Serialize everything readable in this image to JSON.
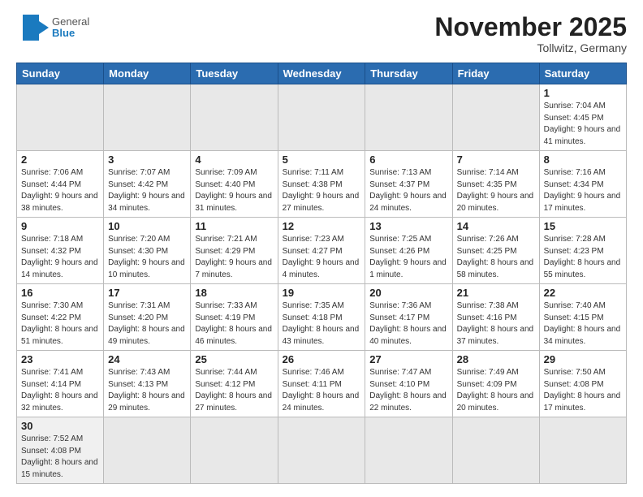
{
  "header": {
    "logo_general": "General",
    "logo_blue": "Blue",
    "month_title": "November 2025",
    "subtitle": "Tollwitz, Germany"
  },
  "weekdays": [
    "Sunday",
    "Monday",
    "Tuesday",
    "Wednesday",
    "Thursday",
    "Friday",
    "Saturday"
  ],
  "weeks": [
    [
      {
        "day": "",
        "info": "",
        "empty": true
      },
      {
        "day": "",
        "info": "",
        "empty": true
      },
      {
        "day": "",
        "info": "",
        "empty": true
      },
      {
        "day": "",
        "info": "",
        "empty": true
      },
      {
        "day": "",
        "info": "",
        "empty": true
      },
      {
        "day": "",
        "info": "",
        "empty": true
      },
      {
        "day": "1",
        "info": "Sunrise: 7:04 AM\nSunset: 4:45 PM\nDaylight: 9 hours\nand 41 minutes."
      }
    ],
    [
      {
        "day": "2",
        "info": "Sunrise: 7:06 AM\nSunset: 4:44 PM\nDaylight: 9 hours\nand 38 minutes."
      },
      {
        "day": "3",
        "info": "Sunrise: 7:07 AM\nSunset: 4:42 PM\nDaylight: 9 hours\nand 34 minutes."
      },
      {
        "day": "4",
        "info": "Sunrise: 7:09 AM\nSunset: 4:40 PM\nDaylight: 9 hours\nand 31 minutes."
      },
      {
        "day": "5",
        "info": "Sunrise: 7:11 AM\nSunset: 4:38 PM\nDaylight: 9 hours\nand 27 minutes."
      },
      {
        "day": "6",
        "info": "Sunrise: 7:13 AM\nSunset: 4:37 PM\nDaylight: 9 hours\nand 24 minutes."
      },
      {
        "day": "7",
        "info": "Sunrise: 7:14 AM\nSunset: 4:35 PM\nDaylight: 9 hours\nand 20 minutes."
      },
      {
        "day": "8",
        "info": "Sunrise: 7:16 AM\nSunset: 4:34 PM\nDaylight: 9 hours\nand 17 minutes."
      }
    ],
    [
      {
        "day": "9",
        "info": "Sunrise: 7:18 AM\nSunset: 4:32 PM\nDaylight: 9 hours\nand 14 minutes."
      },
      {
        "day": "10",
        "info": "Sunrise: 7:20 AM\nSunset: 4:30 PM\nDaylight: 9 hours\nand 10 minutes."
      },
      {
        "day": "11",
        "info": "Sunrise: 7:21 AM\nSunset: 4:29 PM\nDaylight: 9 hours\nand 7 minutes."
      },
      {
        "day": "12",
        "info": "Sunrise: 7:23 AM\nSunset: 4:27 PM\nDaylight: 9 hours\nand 4 minutes."
      },
      {
        "day": "13",
        "info": "Sunrise: 7:25 AM\nSunset: 4:26 PM\nDaylight: 9 hours\nand 1 minute."
      },
      {
        "day": "14",
        "info": "Sunrise: 7:26 AM\nSunset: 4:25 PM\nDaylight: 8 hours\nand 58 minutes."
      },
      {
        "day": "15",
        "info": "Sunrise: 7:28 AM\nSunset: 4:23 PM\nDaylight: 8 hours\nand 55 minutes."
      }
    ],
    [
      {
        "day": "16",
        "info": "Sunrise: 7:30 AM\nSunset: 4:22 PM\nDaylight: 8 hours\nand 51 minutes."
      },
      {
        "day": "17",
        "info": "Sunrise: 7:31 AM\nSunset: 4:20 PM\nDaylight: 8 hours\nand 49 minutes."
      },
      {
        "day": "18",
        "info": "Sunrise: 7:33 AM\nSunset: 4:19 PM\nDaylight: 8 hours\nand 46 minutes."
      },
      {
        "day": "19",
        "info": "Sunrise: 7:35 AM\nSunset: 4:18 PM\nDaylight: 8 hours\nand 43 minutes."
      },
      {
        "day": "20",
        "info": "Sunrise: 7:36 AM\nSunset: 4:17 PM\nDaylight: 8 hours\nand 40 minutes."
      },
      {
        "day": "21",
        "info": "Sunrise: 7:38 AM\nSunset: 4:16 PM\nDaylight: 8 hours\nand 37 minutes."
      },
      {
        "day": "22",
        "info": "Sunrise: 7:40 AM\nSunset: 4:15 PM\nDaylight: 8 hours\nand 34 minutes."
      }
    ],
    [
      {
        "day": "23",
        "info": "Sunrise: 7:41 AM\nSunset: 4:14 PM\nDaylight: 8 hours\nand 32 minutes."
      },
      {
        "day": "24",
        "info": "Sunrise: 7:43 AM\nSunset: 4:13 PM\nDaylight: 8 hours\nand 29 minutes."
      },
      {
        "day": "25",
        "info": "Sunrise: 7:44 AM\nSunset: 4:12 PM\nDaylight: 8 hours\nand 27 minutes."
      },
      {
        "day": "26",
        "info": "Sunrise: 7:46 AM\nSunset: 4:11 PM\nDaylight: 8 hours\nand 24 minutes."
      },
      {
        "day": "27",
        "info": "Sunrise: 7:47 AM\nSunset: 4:10 PM\nDaylight: 8 hours\nand 22 minutes."
      },
      {
        "day": "28",
        "info": "Sunrise: 7:49 AM\nSunset: 4:09 PM\nDaylight: 8 hours\nand 20 minutes."
      },
      {
        "day": "29",
        "info": "Sunrise: 7:50 AM\nSunset: 4:08 PM\nDaylight: 8 hours\nand 17 minutes."
      }
    ],
    [
      {
        "day": "30",
        "info": "Sunrise: 7:52 AM\nSunset: 4:08 PM\nDaylight: 8 hours\nand 15 minutes.",
        "last": true
      },
      {
        "day": "",
        "info": "",
        "empty": true,
        "last": true
      },
      {
        "day": "",
        "info": "",
        "empty": true,
        "last": true
      },
      {
        "day": "",
        "info": "",
        "empty": true,
        "last": true
      },
      {
        "day": "",
        "info": "",
        "empty": true,
        "last": true
      },
      {
        "day": "",
        "info": "",
        "empty": true,
        "last": true
      },
      {
        "day": "",
        "info": "",
        "empty": true,
        "last": true
      }
    ]
  ]
}
